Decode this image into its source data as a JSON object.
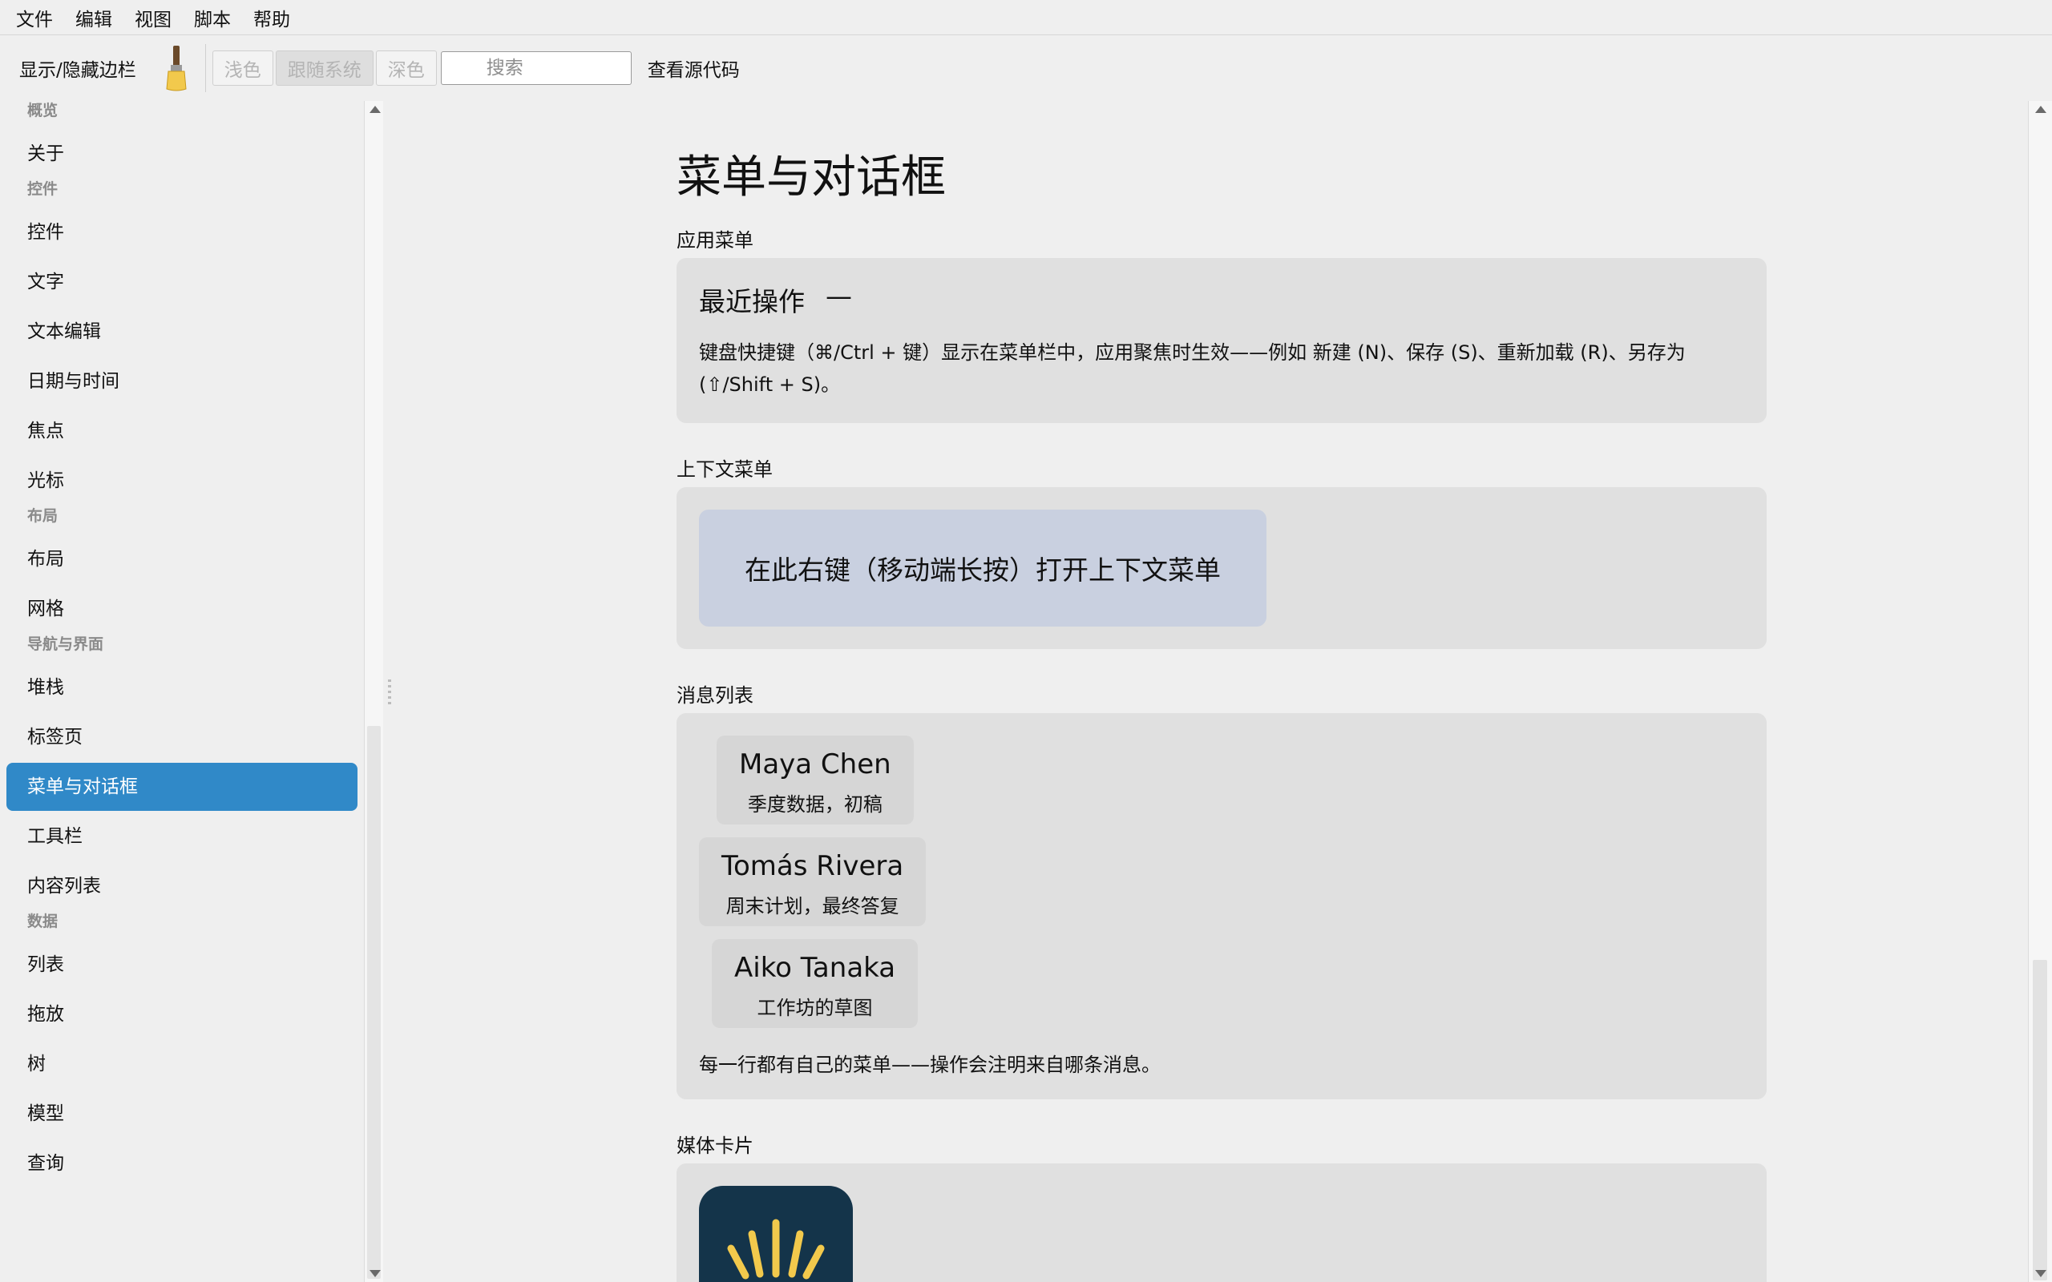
{
  "menubar": {
    "items": [
      "文件",
      "编辑",
      "视图",
      "脚本",
      "帮助"
    ]
  },
  "toolbar": {
    "sidebar_toggle": "显示/隐藏边栏",
    "theme_light": "浅色",
    "theme_system": "跟随系统",
    "theme_dark": "深色",
    "search_placeholder": "搜索",
    "view_source": "查看源代码"
  },
  "sidebar": {
    "groups": {
      "overview": "概览",
      "controls": "控件",
      "layout": "布局",
      "navigation": "导航与界面",
      "data": "数据"
    },
    "items": {
      "about": "关于",
      "controls": "控件",
      "text": "文字",
      "text_edit": "文本编辑",
      "datetime": "日期与时间",
      "focus": "焦点",
      "cursor": "光标",
      "layout": "布局",
      "grid": "网格",
      "stack": "堆栈",
      "tabs": "标签页",
      "menus_dialogs": "菜单与对话框",
      "toolbar": "工具栏",
      "content_list": "内容列表",
      "list": "列表",
      "dragdrop": "拖放",
      "tree": "树",
      "model": "模型",
      "query": "查询"
    },
    "selected": "menus_dialogs"
  },
  "main": {
    "title": "菜单与对话框",
    "app_menu": {
      "label": "应用菜单",
      "recent_title": "最近操作",
      "recent_value": "—",
      "desc": "键盘快捷键（⌘/Ctrl + 键）显示在菜单栏中，应用聚焦时生效——例如 新建 (N)、保存 (S)、重新加载 (R)、另存为 (⇧/Shift + S)。"
    },
    "context_menu": {
      "label": "上下文菜单",
      "area_text": "在此右键（移动端长按）打开上下文菜单"
    },
    "messages": {
      "label": "消息列表",
      "items": [
        {
          "name": "Maya Chen",
          "subject": "季度数据，初稿"
        },
        {
          "name": "Tomás Rivera",
          "subject": "周末计划，最终答复"
        },
        {
          "name": "Aiko Tanaka",
          "subject": "工作坊的草图"
        }
      ],
      "note": "每一行都有自己的菜单——操作会注明来自哪条消息。"
    },
    "media": {
      "label": "媒体卡片"
    }
  },
  "colors": {
    "accent": "#3089c8",
    "card": "#e0e0e0",
    "context_area": "#c9d0e0"
  }
}
